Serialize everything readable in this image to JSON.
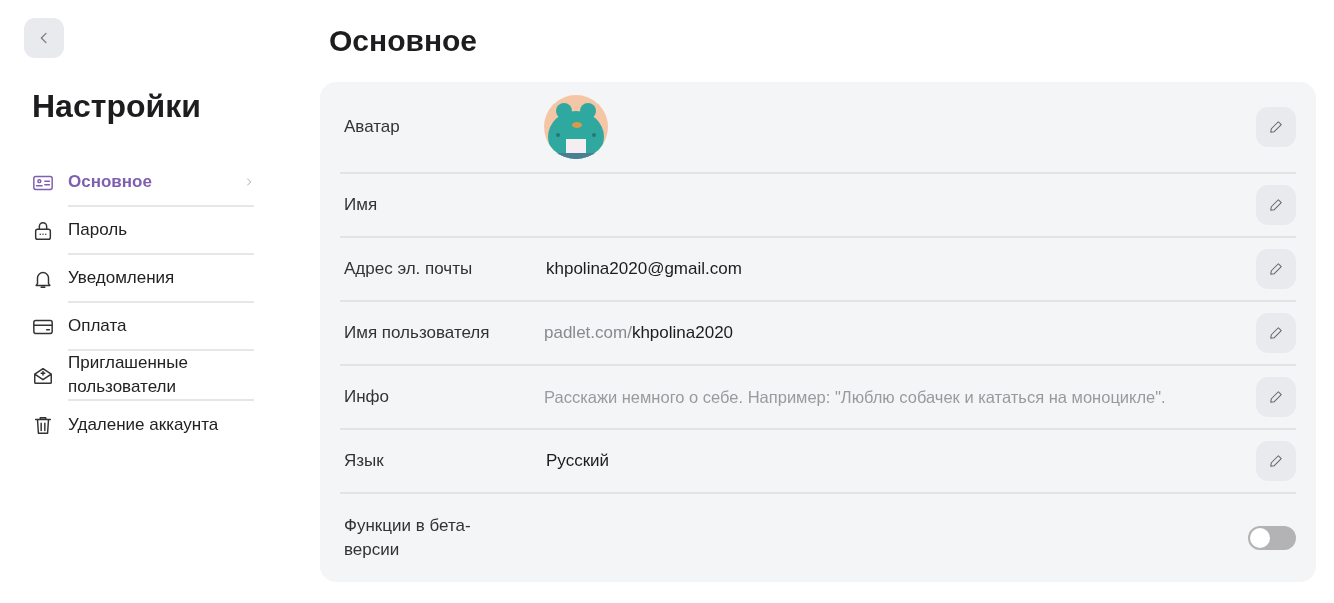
{
  "sidebar": {
    "title": "Настройки",
    "items": [
      {
        "label": "Основное",
        "selected": true
      },
      {
        "label": "Пароль",
        "selected": false
      },
      {
        "label": "Уведомления",
        "selected": false
      },
      {
        "label": "Оплата",
        "selected": false
      },
      {
        "label": "Приглашенные пользователи",
        "selected": false
      },
      {
        "label": "Удаление аккаунта",
        "selected": false
      }
    ]
  },
  "main": {
    "title": "Основное",
    "rows": [
      {
        "kind": "avatar",
        "label": "Аватар"
      },
      {
        "kind": "text",
        "label": "Имя"
      },
      {
        "kind": "text",
        "label": "Адрес эл. почты",
        "value": "khpolina2020@gmail.com"
      },
      {
        "kind": "prefixed",
        "label": "Имя пользователя",
        "prefix": "padlet.com/",
        "value": "khpolina2020"
      },
      {
        "kind": "text",
        "label": "Инфо",
        "placeholder": "Расскажи немного о себе. Например: \"Люблю собачек и кататься на моноцикле\"."
      },
      {
        "kind": "text",
        "label": "Язык",
        "value": "Русский"
      },
      {
        "kind": "toggle",
        "label": "Функции в бета-версии",
        "on": false
      }
    ]
  }
}
